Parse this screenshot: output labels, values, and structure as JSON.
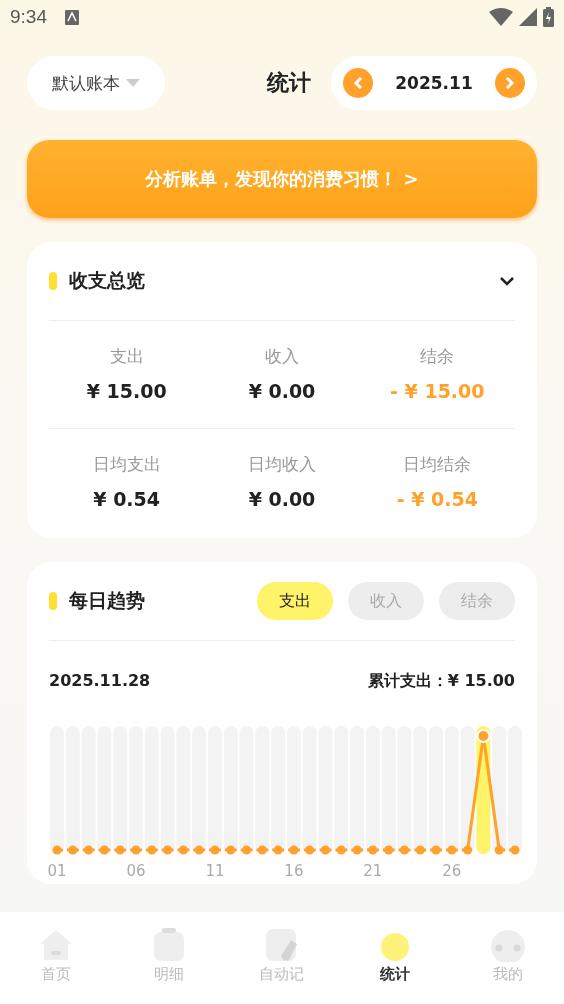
{
  "status_bar": {
    "time": "9:34"
  },
  "header": {
    "ledger": "默认账本",
    "title": "统计",
    "month": "2025.11"
  },
  "banner": {
    "text": "分析账单，发现你的消费习惯！ >"
  },
  "overview": {
    "title": "收支总览",
    "rows": [
      [
        {
          "label": "支出",
          "value": "¥ 15.00",
          "kind": "plain"
        },
        {
          "label": "收入",
          "value": "¥ 0.00",
          "kind": "plain"
        },
        {
          "label": "结余",
          "value": "- ¥ 15.00",
          "kind": "balance"
        }
      ],
      [
        {
          "label": "日均支出",
          "value": "¥ 0.54",
          "kind": "plain"
        },
        {
          "label": "日均收入",
          "value": "¥ 0.00",
          "kind": "plain"
        },
        {
          "label": "日均结余",
          "value": "- ¥ 0.54",
          "kind": "balance"
        }
      ]
    ]
  },
  "trend": {
    "title": "每日趋势",
    "tabs": [
      {
        "label": "支出",
        "selected": true
      },
      {
        "label": "收入",
        "selected": false
      },
      {
        "label": "结余",
        "selected": false
      }
    ],
    "date": "2025.11.28",
    "total": "累计支出：¥ 15.00",
    "x_labels": [
      "01",
      "06",
      "11",
      "16",
      "21",
      "26"
    ],
    "days": [
      {
        "selected": false
      },
      {
        "selected": false
      },
      {
        "selected": false
      },
      {
        "selected": false
      },
      {
        "selected": false
      },
      {
        "selected": false
      },
      {
        "selected": false
      },
      {
        "selected": false
      },
      {
        "selected": false
      },
      {
        "selected": false
      },
      {
        "selected": false
      },
      {
        "selected": false
      },
      {
        "selected": false
      },
      {
        "selected": false
      },
      {
        "selected": false
      },
      {
        "selected": false
      },
      {
        "selected": false
      },
      {
        "selected": false
      },
      {
        "selected": false
      },
      {
        "selected": false
      },
      {
        "selected": false
      },
      {
        "selected": false
      },
      {
        "selected": false
      },
      {
        "selected": false
      },
      {
        "selected": false
      },
      {
        "selected": false
      },
      {
        "selected": false
      },
      {
        "selected": true
      },
      {
        "selected": false
      },
      {
        "selected": false
      }
    ]
  },
  "nav": [
    {
      "label": "首页",
      "selected": false
    },
    {
      "label": "明细",
      "selected": false
    },
    {
      "label": "自动记",
      "selected": false
    },
    {
      "label": "统计",
      "selected": true
    },
    {
      "label": "我的",
      "selected": false
    }
  ]
}
